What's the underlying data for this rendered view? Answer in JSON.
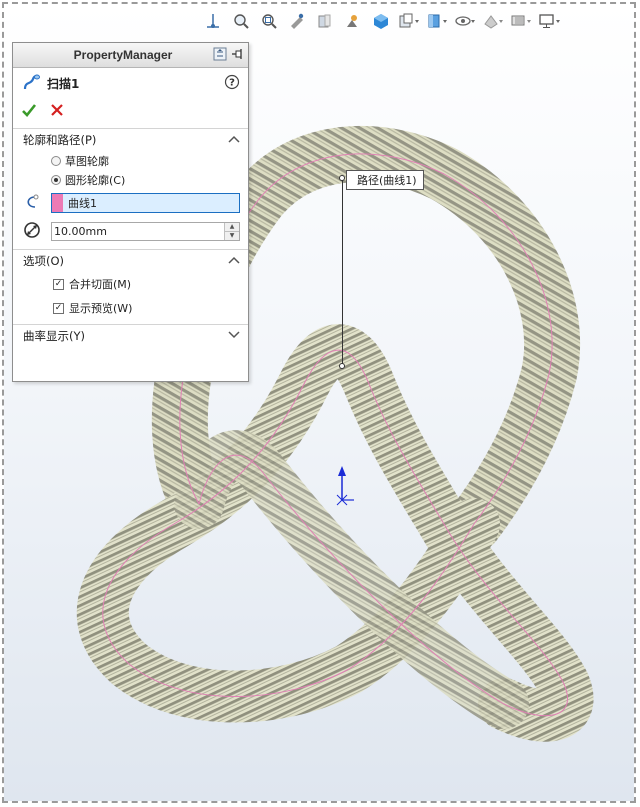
{
  "property_manager": {
    "title": "PropertyManager",
    "feature_name": "扫描1",
    "help_label": "?",
    "profile_path": {
      "header": "轮廓和路径(P)",
      "options": [
        {
          "label": "草图轮廓",
          "selected": false
        },
        {
          "label": "圆形轮廓(C)",
          "selected": true
        }
      ],
      "path_value": "曲线1",
      "diameter_value": "10.00mm"
    },
    "options": {
      "header": "选项(O)",
      "checkboxes": [
        {
          "label": "合并切面(M)",
          "checked": true
        },
        {
          "label": "显示预览(W)",
          "checked": true
        }
      ]
    },
    "curvature": {
      "header": "曲率显示(Y)"
    }
  },
  "callout": {
    "label": "路径(曲线1)"
  },
  "colors": {
    "sweep_body": "#d8d8b8",
    "sweep_stripe": "#8a8a78",
    "path_curve": "#e078b0",
    "selection": "#dbeeff",
    "ok_green": "#3a9a2a",
    "cancel_red": "#d42020"
  },
  "hud_icons": [
    "view-orientation-icon",
    "zoom-to-fit-icon",
    "zoom-to-area-icon",
    "previous-view-icon",
    "section-view-icon",
    "dynamic-annotation-icon",
    "view-cube-icon",
    "display-style-icon",
    "hide-show-icon",
    "edit-appearance-icon",
    "apply-scene-icon",
    "view-settings-icon"
  ]
}
